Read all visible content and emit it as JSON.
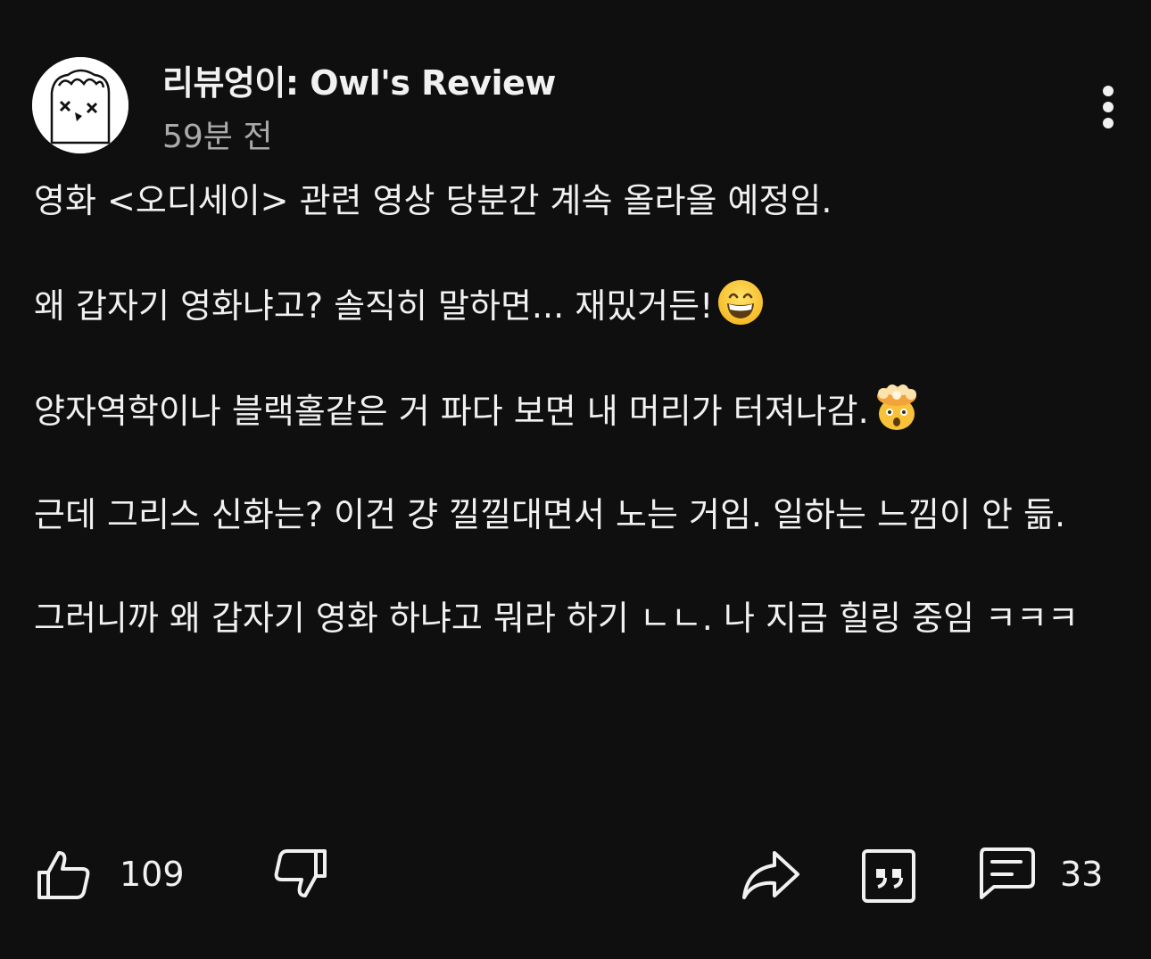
{
  "post": {
    "channel_name": "리뷰엉이: Owl's Review",
    "timestamp": "59분 전",
    "paragraphs": [
      "영화 <오디세이> 관련 영상 당분간 계속 올라올 예정임.",
      "왜 갑자기 영화냐고? 솔직히 말하면... 재밌거든!",
      "양자역학이나 블랙홀같은 거 파다 보면 내 머리가 터져나감.",
      "근데 그리스 신화는? 이건 걍 낄낄대면서 노는 거임. 일하는 느낌이 안 듦.",
      "그러니까 왜 갑자기 영화 하냐고 뭐라 하기 ㄴㄴ. 나 지금 힐링 중임 ㅋㅋㅋ"
    ],
    "emojis": [
      "grinning-face-emoji",
      "exploding-head-emoji"
    ]
  },
  "actions": {
    "like_count": "109",
    "comment_count": "33"
  },
  "icons": [
    "more-vertical-icon",
    "thumbs-up-icon",
    "thumbs-down-icon",
    "share-icon",
    "quote-icon",
    "comment-icon"
  ],
  "colors": {
    "background": "#0f0f0f",
    "text": "#f1f1f1",
    "secondary_text": "#aaaaaa"
  }
}
